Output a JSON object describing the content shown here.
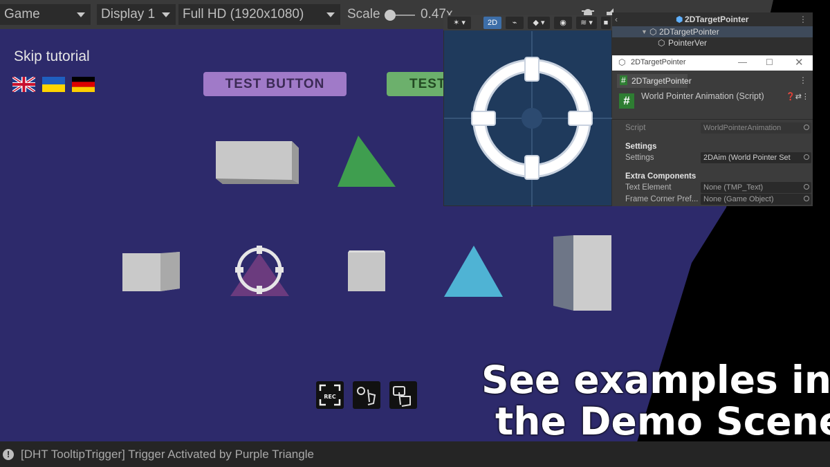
{
  "toolbar": {
    "game_tab": "Game",
    "display": "Display 1",
    "resolution": "Full HD (1920x1080)",
    "scale_label": "Scale",
    "scale_value": "0.47x"
  },
  "game": {
    "skip_tutorial": "Skip tutorial",
    "flags": [
      "uk-flag",
      "ukraine-flag",
      "germany-flag"
    ],
    "test_button_1": "TEST BUTTON",
    "test_button_2": "TEST"
  },
  "status_bar": {
    "message": "[DHT TooltipTrigger] Trigger Activated by Purple Triangle"
  },
  "scene_view": {
    "mode_2d": "2D"
  },
  "hierarchy": {
    "root": "2DTargetPointer",
    "child": "2DTargetPointer",
    "grandchild": "PointerVer"
  },
  "inspector": {
    "window_title": "2DTargetPointer",
    "tab_label": "2DTargetPointer",
    "component_title": "World Pointer Animation (Script)",
    "script_label": "Script",
    "script_value": "WorldPointerAnimation",
    "settings_header": "Settings",
    "settings_label": "Settings",
    "settings_value": "2DAim (World Pointer Set",
    "extra_header": "Extra Components",
    "text_element_label": "Text Element",
    "text_element_value": "None (TMP_Text)",
    "frame_corner_label": "Frame Corner Pref...",
    "frame_corner_value": "None (Game Object)"
  },
  "caption": {
    "line1": "See examples in",
    "line2": "the Demo Scene"
  },
  "colors": {
    "viewport": "#2d2a6b",
    "purple_button": "#a07ac8",
    "green_button": "#6cb06c",
    "green_triangle": "#3f9e4f",
    "blue_triangle": "#4fb3d4",
    "purple_triangle": "#6b3b7e",
    "scene_bg": "#1f3a5c"
  }
}
